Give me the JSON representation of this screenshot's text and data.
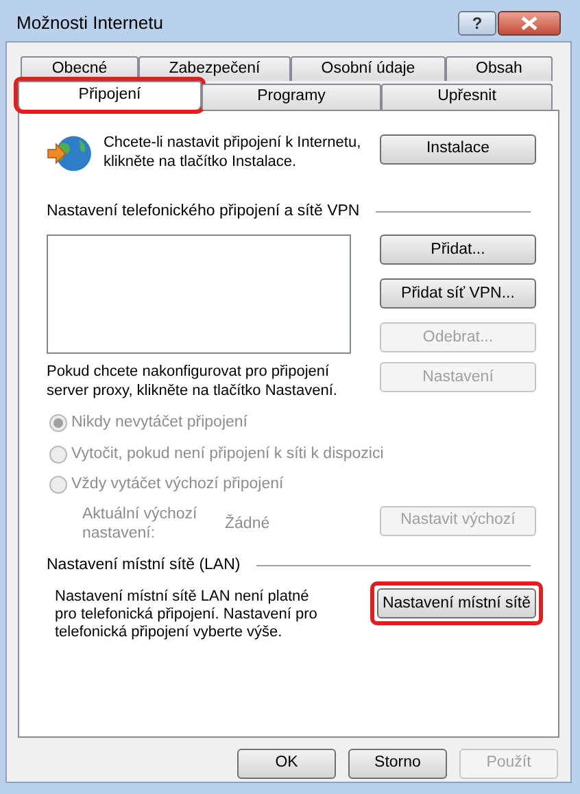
{
  "window": {
    "title": "Možnosti Internetu",
    "help_button": "?"
  },
  "tab_rows": [
    [
      {
        "label": "Obecné",
        "selected": false
      },
      {
        "label": "Zabezpečení",
        "selected": false
      },
      {
        "label": "Osobní údaje",
        "selected": false
      },
      {
        "label": "Obsah",
        "selected": false
      }
    ],
    [
      {
        "label": "Připojení",
        "selected": true,
        "highlighted": true
      },
      {
        "label": "Programy",
        "selected": false,
        "highlighted": false
      },
      {
        "label": "Upřesnit",
        "selected": false,
        "highlighted": false
      }
    ]
  ],
  "setup": {
    "text": "Chcete-li nastavit připojení k Internetu, klikněte na tlačítko Instalace.",
    "button": {
      "label": "Instalace",
      "disabled": false
    }
  },
  "dialup": {
    "heading": "Nastavení telefonického připojení a sítě VPN",
    "buttons": [
      {
        "label": "Přidat...",
        "disabled": false
      },
      {
        "label": "Přidat síť VPN...",
        "disabled": false
      },
      {
        "label": "Odebrat...",
        "disabled": true
      }
    ],
    "proxy_text": "Pokud chcete nakonfigurovat pro připojení server proxy, klikněte na tlačítko Nastavení.",
    "proxy_button": {
      "label": "Nastavení",
      "disabled": true
    },
    "radios": [
      {
        "label": "Nikdy nevytáčet připojení",
        "selected": true,
        "disabled": true
      },
      {
        "label": "Vytočit, pokud není připojení k síti k dispozici",
        "selected": false,
        "disabled": true
      },
      {
        "label": "Vždy vytáčet výchozí připojení",
        "selected": false,
        "disabled": true
      }
    ],
    "default_label": "Aktuální výchozí nastavení:",
    "default_value": "Žádné",
    "default_button": {
      "label": "Nastavit výchozí",
      "disabled": true
    }
  },
  "lan": {
    "heading": "Nastavení místní sítě (LAN)",
    "text": "Nastavení místní sítě LAN není platné pro telefonická připojení. Nastavení pro telefonická připojení vyberte výše.",
    "button": {
      "label": "Nastavení místní sítě",
      "disabled": false,
      "highlighted": true
    }
  },
  "footer": [
    {
      "label": "OK",
      "disabled": false
    },
    {
      "label": "Storno",
      "disabled": false
    },
    {
      "label": "Použít",
      "disabled": true
    }
  ]
}
